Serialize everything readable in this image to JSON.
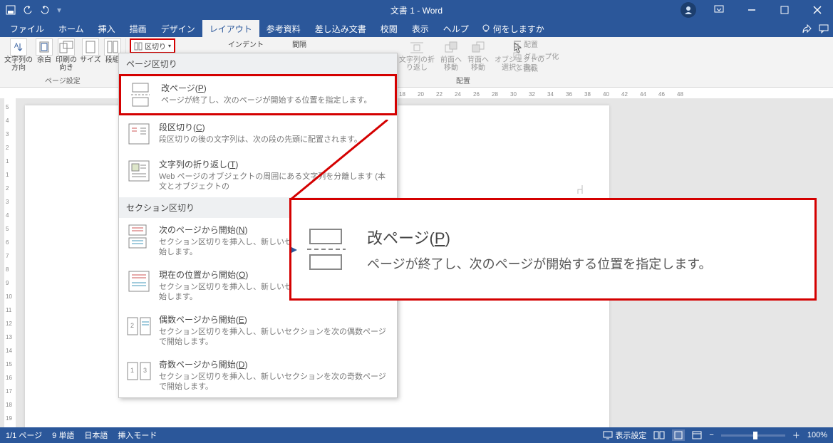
{
  "titlebar": {
    "title": "文書 1 - Word"
  },
  "tabs": {
    "items": [
      "ファイル",
      "ホーム",
      "挿入",
      "描画",
      "デザイン",
      "レイアウト",
      "参考資料",
      "差し込み文書",
      "校閲",
      "表示",
      "ヘルプ"
    ],
    "active": 5,
    "tellme": "何をしますか"
  },
  "ribbon": {
    "page_setup": {
      "label": "ページ設定",
      "text_direction": "文字列の\n方向",
      "margins": "余白",
      "orientation": "印刷の\n向き",
      "size": "サイズ",
      "columns": "段組"
    },
    "breaks_button": "区切り",
    "indent": {
      "label": "インデント"
    },
    "spacing": {
      "label": "間隔"
    },
    "arrange": {
      "label": "配置",
      "wrap": "文字列の折\nり返し",
      "forward": "前面へ\n移動",
      "backward": "背面へ\n移動",
      "select": "オブジェクトの\n選択と表示",
      "align": "配置",
      "group": "グループ化",
      "rotate": "回転"
    }
  },
  "ruler": {
    "h": [
      "18",
      "20",
      "22",
      "24",
      "26",
      "28",
      "30",
      "32",
      "34",
      "36",
      "38",
      "40",
      "42",
      "44",
      "46",
      "48"
    ],
    "v": [
      "5",
      "4",
      "3",
      "2",
      "1",
      "1",
      "2",
      "3",
      "4",
      "5",
      "6",
      "7",
      "8",
      "9",
      "10",
      "11",
      "12",
      "13",
      "14",
      "15",
      "16",
      "17",
      "18",
      "19"
    ]
  },
  "dropdown": {
    "section1": "ページ区切り",
    "items1": [
      {
        "title": "改ページ(",
        "key": "P",
        "title2": ")",
        "desc": "ページが終了し、次のページが開始する位置を指定します。",
        "icon": "pagebreak"
      },
      {
        "title": "段区切り(",
        "key": "C",
        "title2": ")",
        "desc": "段区切りの後の文字列は、次の段の先頭に配置されます。",
        "icon": "colbreak"
      },
      {
        "title": "文字列の折り返し(",
        "key": "T",
        "title2": ")",
        "desc": "Web ページのオブジェクトの周囲にある文字列を分離します (本文とオブジェクトの",
        "icon": "textwrap"
      }
    ],
    "section2": "セクション区切り",
    "items2": [
      {
        "title": "次のページから開始(",
        "key": "N",
        "title2": ")",
        "desc": "セクション区切りを挿入し、新しいセクションを次のページで開始します。",
        "icon": "nextpage"
      },
      {
        "title": "現在の位置から開始(",
        "key": "O",
        "title2": ")",
        "desc": "セクション区切りを挿入し、新しいセクションを同じページで開始します。",
        "icon": "samepage"
      },
      {
        "title": "偶数ページから開始(",
        "key": "E",
        "title2": ")",
        "desc": "セクション区切りを挿入し、新しいセクションを次の偶数ページで開始します。",
        "icon": "evenpage"
      },
      {
        "title": "奇数ページから開始(",
        "key": "D",
        "title2": ")",
        "desc": "セクション区切りを挿入し、新しいセクションを次の奇数ページで開始します。",
        "icon": "oddpage"
      }
    ]
  },
  "callout": {
    "title_a": "改ページ(",
    "title_key": "P",
    "title_b": ")",
    "desc": "ページが終了し、次のページが開始する位置を指定します。"
  },
  "status": {
    "page": "1/1 ページ",
    "words": "9 単語",
    "lang": "日本語",
    "mode": "挿入モード",
    "display": "表示設定",
    "zoom": "100%"
  }
}
